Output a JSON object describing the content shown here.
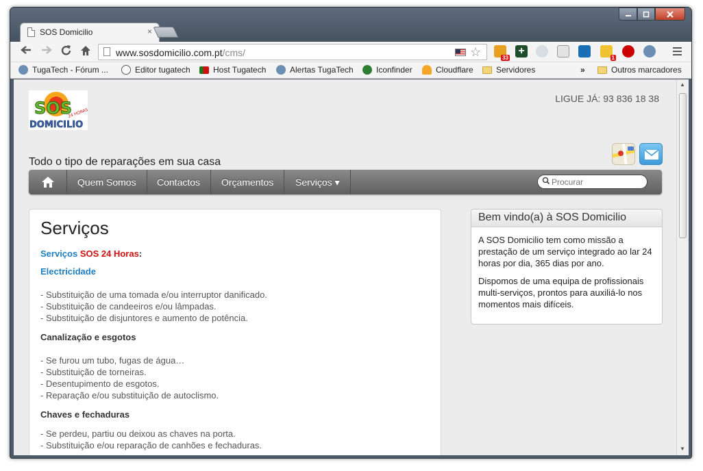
{
  "browser": {
    "tab_title": "SOS Domicilio",
    "tab_close": "×",
    "url_host": "www.sosdomicilio.com.pt",
    "url_path": "/cms/",
    "ext_badges": [
      "33",
      "1"
    ],
    "bookmarks": [
      {
        "label": "TugaTech - Fórum ...",
        "icon": "tugatech-icon"
      },
      {
        "label": "Editor tugatech",
        "icon": "gauge-icon"
      },
      {
        "label": "Host Tugatech",
        "icon": "portugal-flag-icon"
      },
      {
        "label": "Alertas TugaTech",
        "icon": "tugatech-icon"
      },
      {
        "label": "Iconfinder",
        "icon": "iconfinder-icon"
      },
      {
        "label": "Cloudflare",
        "icon": "cloudflare-icon"
      },
      {
        "label": "Servidores",
        "icon": "folder-icon"
      }
    ],
    "bookmarks_overflow": "»",
    "other_bookmarks": "Outros marcadores"
  },
  "site": {
    "phone": "LIGUE JÁ: 93 836 18 38",
    "tagline": "Todo o tipo de reparações em sua casa",
    "nav": [
      "Quem Somos",
      "Contactos",
      "Orçamentos",
      "Serviços ▾"
    ],
    "search_placeholder": "Procurar",
    "content": {
      "title": "Serviços",
      "intro_1": "Serviços",
      "intro_2": "SOS 24 Horas",
      "intro_3": ":",
      "electricidade": {
        "title": "Electricidade",
        "items": [
          "- Substituição de uma tomada e/ou  interruptor danificado.",
          "- Substituição de candeeiros e/ou lâmpadas.",
          "- Substituição de disjuntores e aumento de potência."
        ]
      },
      "canalizacao": {
        "title": "Canalização e esgotos",
        "items": [
          "- Se furou um tubo, fugas de água…",
          "- Substituição de torneiras.",
          "- Desentupimento de esgotos.",
          "- Reparação e/ou substituição de autoclismo."
        ]
      },
      "chaves": {
        "title": "Chaves e fechaduras",
        "items": [
          "- Se perdeu, partiu ou deixou as chaves na porta.",
          "- Substituição e/ou reparação de canhões e fechaduras."
        ]
      }
    },
    "sidebar": {
      "title": "Bem vindo(a) à SOS Domicilio",
      "p1": "A SOS Domicilio tem como missão a prestação de um serviço integrado ao lar 24 horas por dia, 365 dias por ano.",
      "p2": "Dispomos de uma equipa de profissionais multi-serviços, prontos para auxiliá-lo nos momentos mais difíceis."
    },
    "logo_text_1": "SOS",
    "logo_text_2": "DOMICILIO",
    "logo_text_3": "24 HORAS"
  }
}
